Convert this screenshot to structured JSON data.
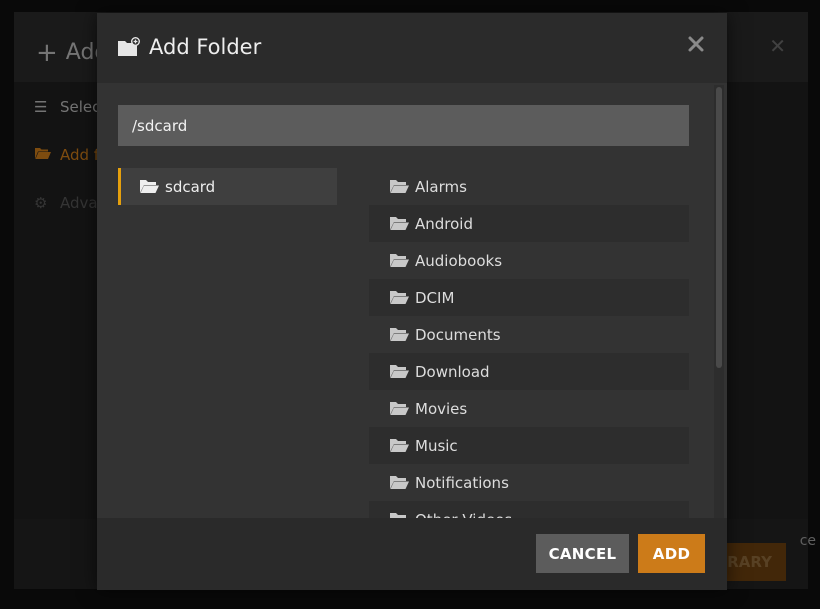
{
  "background_dialog": {
    "title": "Add",
    "nav": [
      {
        "label": "Selec",
        "icon": "list-icon"
      },
      {
        "label": "Add f",
        "icon": "folder-open-icon"
      },
      {
        "label": "Adva",
        "icon": "gear-icon"
      }
    ],
    "footer_button": "RARY",
    "edge_text": "ce"
  },
  "modal": {
    "title": "Add Folder",
    "path_value": "/sdcard",
    "root_items": [
      "sdcard"
    ],
    "folders": [
      "Alarms",
      "Android",
      "Audiobooks",
      "DCIM",
      "Documents",
      "Download",
      "Movies",
      "Music",
      "Notifications",
      "Other Videos"
    ],
    "cancel_label": "CANCEL",
    "add_label": "ADD"
  },
  "colors": {
    "accent": "#cc7b19",
    "selection_bar": "#e5a00d"
  }
}
